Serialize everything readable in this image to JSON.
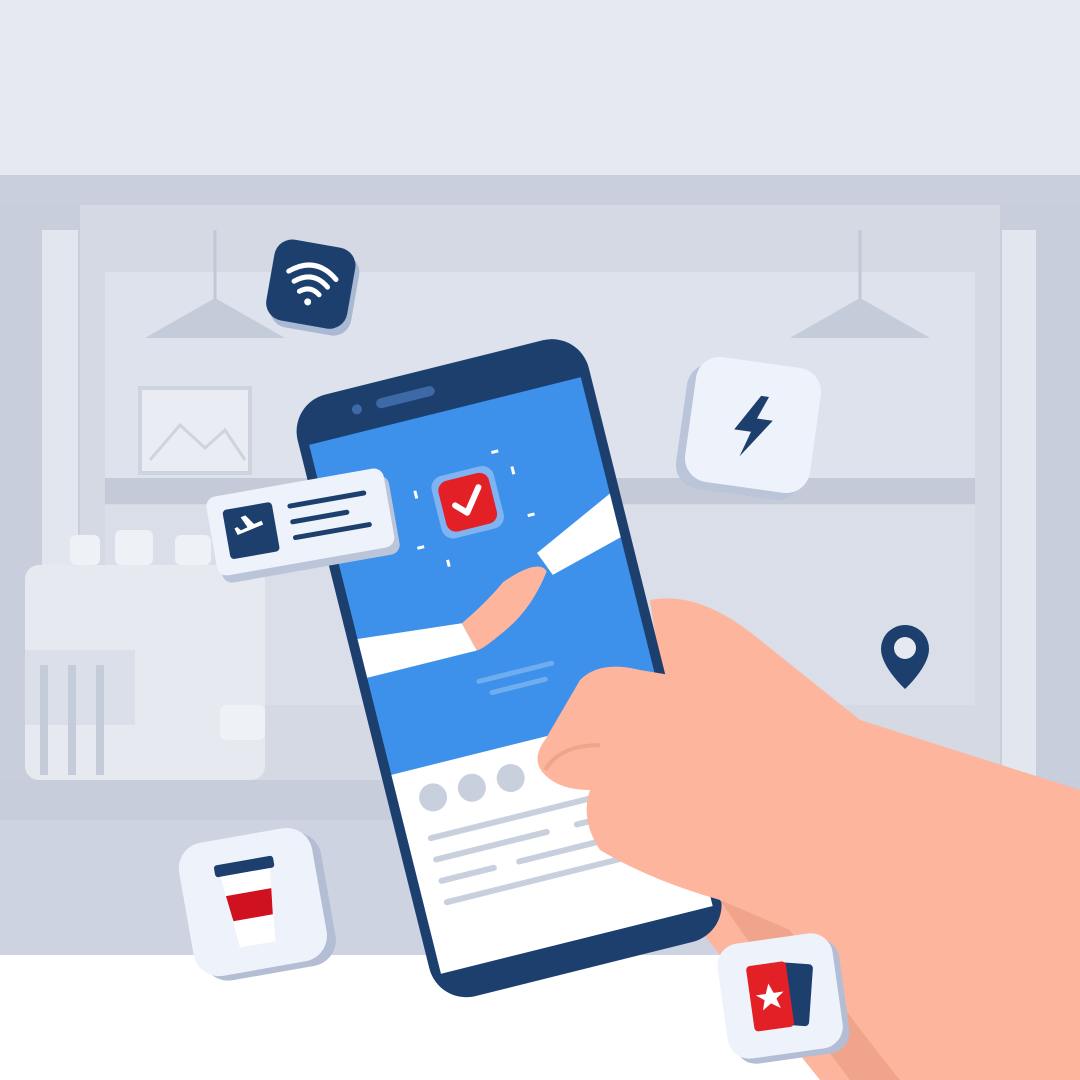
{
  "scene": {
    "description_visible_text": "",
    "background": {
      "sky_color": "#e6e9f0",
      "cafe_wall_color": "#cfd5e2",
      "counter_color": "#ffffff",
      "shelf_color": "#dde2ec"
    },
    "phone": {
      "frame_color": "#1d3f6e",
      "screen_color": "#3d91ea",
      "card_color": "#ffffff",
      "checkmark_badge_color": "#e32026",
      "content_icons": [
        "checkmark-icon",
        "handshake-illustration"
      ]
    },
    "hand": {
      "skin_color": "#fdb59d",
      "shadow_color": "#f0a48b"
    },
    "floating_icons": [
      {
        "name": "wifi-icon",
        "tile_color": "#1d3f6e",
        "glyph_color": "#ffffff"
      },
      {
        "name": "lightning-icon",
        "tile_color": "#eef2fa",
        "glyph_color": "#1d3f6e"
      },
      {
        "name": "boarding-pass-icon",
        "tile_color": "#eef2fa",
        "glyph_color": "#1d3f6e"
      },
      {
        "name": "location-pin-icon",
        "tile_color": "none",
        "glyph_color": "#1d3f6e"
      },
      {
        "name": "coffee-cup-icon",
        "tile_color": "#eef2fa",
        "glyph_color": "#e32026"
      },
      {
        "name": "ticket-icon",
        "tile_color": "#eef2fa",
        "glyph_color": "#e32026"
      }
    ]
  }
}
